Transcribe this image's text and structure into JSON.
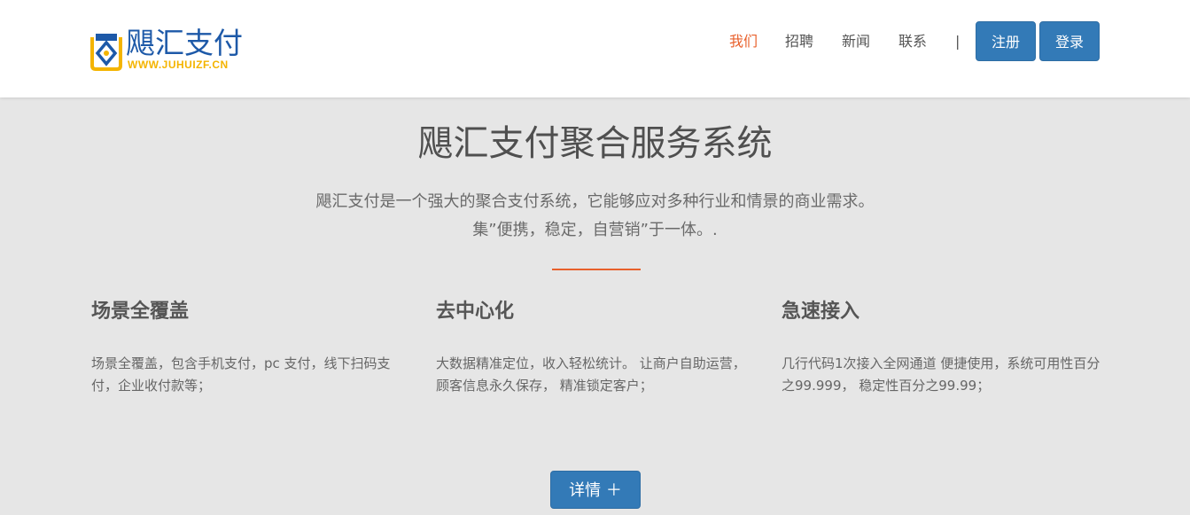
{
  "logo": {
    "name": "飓汇支付",
    "url": "WWW.JUHUIZF.CN",
    "colors": {
      "blue": "#1d59a8",
      "yellow": "#f4b400"
    }
  },
  "nav": {
    "items": [
      {
        "label": "我们",
        "active": true
      },
      {
        "label": "招聘",
        "active": false
      },
      {
        "label": "新闻",
        "active": false
      },
      {
        "label": "联系",
        "active": false
      }
    ],
    "separator": "|",
    "register_label": "注册",
    "login_label": "登录"
  },
  "hero": {
    "title": "飓汇支付聚合服务系统",
    "desc_line1": "飓汇支付是一个强大的聚合支付系统，它能够应对多种行业和情景的商业需求。",
    "desc_line2": "集”便携，稳定，自营销”于一体。."
  },
  "features": [
    {
      "title": "场景全覆盖",
      "text": "场景全覆盖，包含手机支付，pc 支付，线下扫码支付，企业收付款等；"
    },
    {
      "title": "去中心化",
      "text": "大数据精准定位，收入轻松统计。 让商户自助运营，顾客信息永久保存， 精准锁定客户；"
    },
    {
      "title": "急速接入",
      "text": "几行代码1次接入全网通道 便捷使用，系统可用性百分之99.999， 稳定性百分之99.99；"
    }
  ],
  "more_button": {
    "label": "详情 ＋"
  },
  "colors": {
    "accent": "#e8602c",
    "primary": "#337ab7",
    "background": "#e6e6e6"
  }
}
